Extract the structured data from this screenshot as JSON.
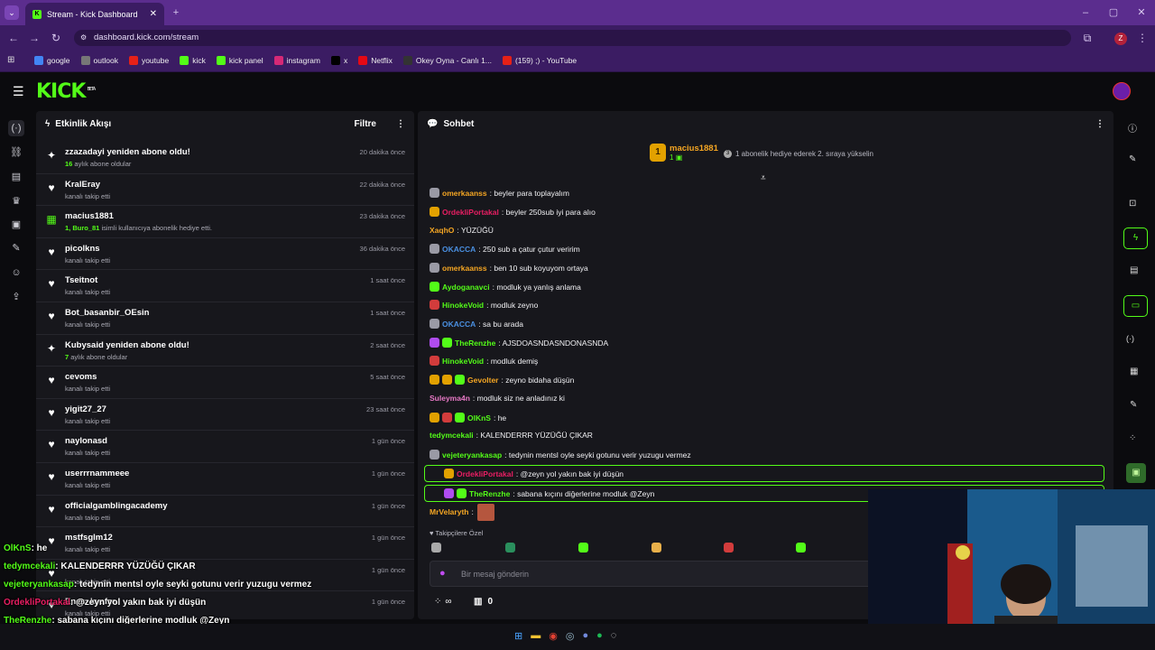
{
  "browser": {
    "tab_title": "Stream - Kick Dashboard",
    "url": "dashboard.kick.com/stream",
    "profile": "Z",
    "bookmarks": [
      {
        "label": "google",
        "color": "#4285f4"
      },
      {
        "label": "outlook",
        "color": "#777"
      },
      {
        "label": "youtube",
        "color": "#e62117"
      },
      {
        "label": "kick",
        "color": "#53fc18"
      },
      {
        "label": "kick panel",
        "color": "#53fc18"
      },
      {
        "label": "instagram",
        "color": "#d62976"
      },
      {
        "label": "x",
        "color": "#000"
      },
      {
        "label": "Netflix",
        "color": "#e50914"
      },
      {
        "label": "Okey Oyna - Canlı 1...",
        "color": "#333"
      },
      {
        "label": "(159) ;) - YouTube",
        "color": "#e62117"
      }
    ]
  },
  "app": {
    "logo": "KICK",
    "badge": "BETA"
  },
  "activity": {
    "title": "Etkinlik Akışı",
    "filter": "Filtre",
    "items": [
      {
        "icon": "sparkle",
        "name": "zzazadayi yeniden abone oldu!",
        "hl": "16",
        "sub": " aylık abone oldular",
        "time": "20 dakika önce"
      },
      {
        "icon": "heart",
        "name": "KralEray",
        "hl": "",
        "sub": "kanalı takip etti",
        "time": "22 dakika önce"
      },
      {
        "icon": "gift",
        "name": "macius1881",
        "hl": "1, Buro_81",
        "sub": " isimli kullanıcıya abonelik hediye etti.",
        "time": "23 dakika önce"
      },
      {
        "icon": "heart",
        "name": "picolkns",
        "hl": "",
        "sub": "kanalı takip etti",
        "time": "36 dakika önce"
      },
      {
        "icon": "heart",
        "name": "Tseitnot",
        "hl": "",
        "sub": "kanalı takip etti",
        "time": "1 saat önce"
      },
      {
        "icon": "heart",
        "name": "Bot_basanbir_OEsin",
        "hl": "",
        "sub": "kanalı takip etti",
        "time": "1 saat önce"
      },
      {
        "icon": "sparkle",
        "name": "Kubysaid yeniden abone oldu!",
        "hl": "7",
        "sub": " aylık abone oldular",
        "time": "2 saat önce"
      },
      {
        "icon": "heart",
        "name": "cevoms",
        "hl": "",
        "sub": "kanalı takip etti",
        "time": "5 saat önce"
      },
      {
        "icon": "heart",
        "name": "yigit27_27",
        "hl": "",
        "sub": "kanalı takip etti",
        "time": "23 saat önce"
      },
      {
        "icon": "heart",
        "name": "naylonasd",
        "hl": "",
        "sub": "kanalı takip etti",
        "time": "1 gün önce"
      },
      {
        "icon": "heart",
        "name": "userrrnammeee",
        "hl": "",
        "sub": "kanalı takip etti",
        "time": "1 gün önce"
      },
      {
        "icon": "heart",
        "name": "officialgamblingacademy",
        "hl": "",
        "sub": "kanalı takip etti",
        "time": "1 gün önce"
      },
      {
        "icon": "heart",
        "name": "mstfsglm12",
        "hl": "",
        "sub": "kanalı takip etti",
        "time": "1 gün önce"
      },
      {
        "icon": "heart",
        "name": "",
        "hl": "",
        "sub": "kanalı takip etti",
        "time": "1 gün önce"
      },
      {
        "icon": "heart",
        "name": "Enes_kyafzc",
        "hl": "",
        "sub": "kanalı takip etti",
        "time": "1 gün önce"
      }
    ]
  },
  "chat": {
    "title": "Sohbet",
    "top_gifter": "macius1881",
    "top_count": "1",
    "rank_badge": "1",
    "promo": "1 abonelik hediye ederek 2. sıraya yükselin",
    "messages": [
      {
        "user": "omerkaanss",
        "color": "#f5a623",
        "text": ": beyler para toplayalım",
        "badges": [
          "gray"
        ]
      },
      {
        "user": "OrdekliPortakal",
        "color": "#e91e63",
        "text": ": beyler 250sub iyi para alıo",
        "badges": [
          "gold"
        ]
      },
      {
        "user": "XaqhO",
        "color": "#f5a623",
        "text": ": YÜZÜĞÜ",
        "badges": []
      },
      {
        "user": "OKACCA",
        "color": "#4a90e2",
        "text": ": 250 sub a çatur çutur veririm",
        "badges": [
          "gray"
        ]
      },
      {
        "user": "omerkaanss",
        "color": "#f5a623",
        "text": ": ben 10 sub koyuyom ortaya",
        "badges": [
          "gray"
        ]
      },
      {
        "user": "Aydoganavci",
        "color": "#53fc18",
        "text": ": modluk ya yanlış anlama",
        "badges": [
          "green"
        ]
      },
      {
        "user": "HinokeVoid",
        "color": "#53fc18",
        "text": ": modluk zeyno",
        "badges": [
          "red"
        ]
      },
      {
        "user": "OKACCA",
        "color": "#4a90e2",
        "text": ": sa bu arada",
        "badges": [
          "gray"
        ]
      },
      {
        "user": "TheRenzhe",
        "color": "#53fc18",
        "text": ": AJSDOASNDASNDONASNDA",
        "badges": [
          "purple",
          "green"
        ]
      },
      {
        "user": "HinokeVoid",
        "color": "#53fc18",
        "text": ": modluk demiş",
        "badges": [
          "red"
        ]
      },
      {
        "user": "Gevolter",
        "color": "#f5a623",
        "text": ": zeyno bidaha düşün",
        "badges": [
          "gold",
          "coin",
          "green"
        ]
      },
      {
        "user": "Suleyma4n",
        "color": "#e879c6",
        "text": ": modluk siz ne anladınız ki",
        "badges": []
      },
      {
        "user": "OlKnS",
        "color": "#53fc18",
        "text": ": he",
        "badges": [
          "gold",
          "red",
          "green"
        ]
      },
      {
        "user": "tedymcekali",
        "color": "#53fc18",
        "text": ": KALENDERRR YÜZÜĞÜ ÇIKAR",
        "badges": []
      },
      {
        "user": "vejeteryankasap",
        "color": "#53fc18",
        "text": ": tedynin mentsl oyle seyki gotunu verir yuzugu vermez",
        "badges": [
          "gray"
        ]
      },
      {
        "user": "OrdekliPortakal",
        "color": "#e91e63",
        "text": ": @zeyn yol yakın bak iyi düşün",
        "badges": [
          "gold"
        ]
      },
      {
        "user": "TheRenzhe",
        "color": "#53fc18",
        "text": ": sabana kıçını diğerlerine modluk @Zeyn",
        "badges": [
          "purple",
          "green"
        ]
      },
      {
        "user": "MrVelaryth",
        "color": "#f5a623",
        "text": ":",
        "badges": []
      }
    ],
    "followers_only": "Takipçilere Özel",
    "input_placeholder": "Bir mesaj gönderin",
    "points": "∞",
    "gift_count": "0"
  },
  "overlay": [
    {
      "user": "OlKnS",
      "text": ": he",
      "color": "#53fc18"
    },
    {
      "user": "tedymcekali",
      "text": ": KALENDERRR YÜZÜĞÜ ÇIKAR",
      "color": "#53fc18"
    },
    {
      "user": "vejeteryankasap",
      "text": ": tedynin mentsl oyle seyki gotunu verir yuzugu vermez",
      "color": "#53fc18"
    },
    {
      "user": "OrdekliPortakal",
      "text": ": @zeyn yol yakın bak iyi düşün",
      "color": "#e91e63"
    },
    {
      "user": "TheRenzhe",
      "text": ": sabana kıçını diğerlerine modluk @Zeyn",
      "color": "#53fc18"
    }
  ]
}
